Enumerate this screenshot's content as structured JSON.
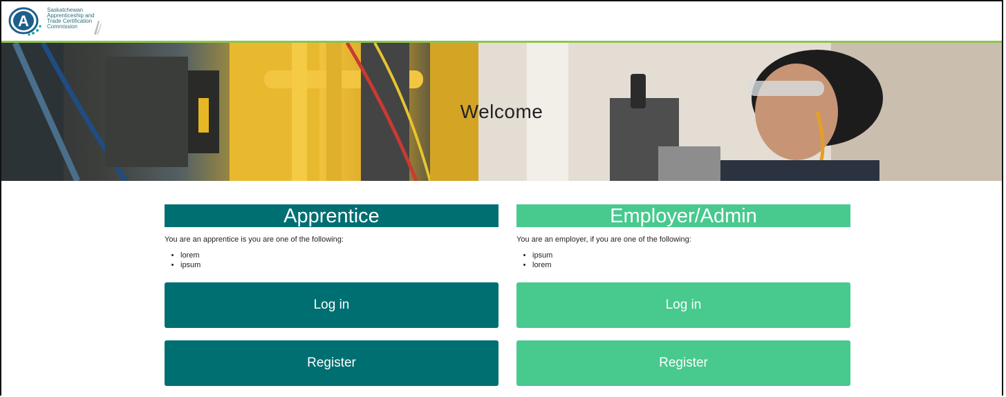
{
  "header": {
    "logo_lines": [
      "Saskatchewan",
      "Apprenticeship and",
      "Trade Certification",
      "Commission"
    ],
    "logo_letter": "A"
  },
  "hero": {
    "title": "Welcome"
  },
  "apprentice": {
    "title": "Apprentice",
    "description": "You are an apprentice is you are one of the following:",
    "items": [
      "lorem",
      "ipsum"
    ],
    "login_label": "Log in",
    "register_label": "Register",
    "color": "#006f72"
  },
  "employer": {
    "title": "Employer/Admin",
    "description": "You are an employer, if you are one of the following:",
    "items": [
      "ipsum",
      "lorem"
    ],
    "login_label": "Log in",
    "register_label": "Register",
    "color": "#48c98e"
  },
  "accent_colors": {
    "header_rule": "#8cc44d"
  }
}
